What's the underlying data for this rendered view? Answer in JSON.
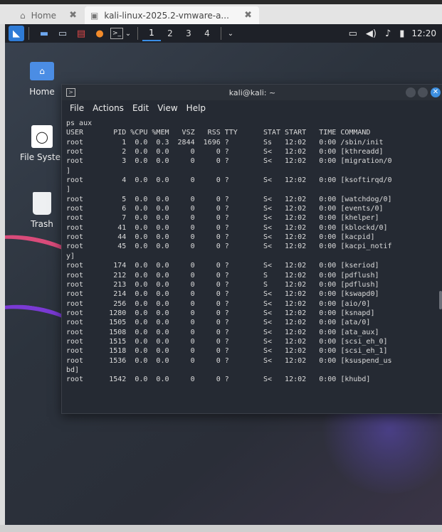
{
  "vm_tabs": [
    {
      "label": "Home",
      "icon": "home-icon"
    },
    {
      "label": "kali-linux-2025.2-vmware-a...",
      "icon": "vm-icon"
    }
  ],
  "panel": {
    "workspaces": [
      "1",
      "2",
      "3",
      "4"
    ],
    "active_workspace": "1",
    "clock": "12:20"
  },
  "desktop_icons": [
    {
      "label": "Home",
      "icon": "home-folder-icon"
    },
    {
      "label": "File Syster",
      "icon": "drive-icon"
    },
    {
      "label": "Trash",
      "icon": "trash-icon"
    }
  ],
  "terminal": {
    "title": "kali@kali: ~",
    "menu": [
      "File",
      "Actions",
      "Edit",
      "View",
      "Help"
    ],
    "lines": [
      "ps aux",
      "USER       PID %CPU %MEM   VSZ   RSS TTY      STAT START   TIME COMMAND",
      "root         1  0.0  0.3  2844  1696 ?        Ss   12:02   0:00 /sbin/init",
      "root         2  0.0  0.0     0     0 ?        S<   12:02   0:00 [kthreadd]",
      "root         3  0.0  0.0     0     0 ?        S<   12:02   0:00 [migration/0",
      "]",
      "root         4  0.0  0.0     0     0 ?        S<   12:02   0:00 [ksoftirqd/0",
      "]",
      "root         5  0.0  0.0     0     0 ?        S<   12:02   0:00 [watchdog/0]",
      "root         6  0.0  0.0     0     0 ?        S<   12:02   0:00 [events/0]",
      "root         7  0.0  0.0     0     0 ?        S<   12:02   0:00 [khelper]",
      "root        41  0.0  0.0     0     0 ?        S<   12:02   0:00 [kblockd/0]",
      "root        44  0.0  0.0     0     0 ?        S<   12:02   0:00 [kacpid]",
      "root        45  0.0  0.0     0     0 ?        S<   12:02   0:00 [kacpi_notif",
      "y]",
      "root       174  0.0  0.0     0     0 ?        S<   12:02   0:00 [kseriod]",
      "root       212  0.0  0.0     0     0 ?        S    12:02   0:00 [pdflush]",
      "root       213  0.0  0.0     0     0 ?        S    12:02   0:00 [pdflush]",
      "root       214  0.0  0.0     0     0 ?        S<   12:02   0:00 [kswapd0]",
      "root       256  0.0  0.0     0     0 ?        S<   12:02   0:00 [aio/0]",
      "root      1280  0.0  0.0     0     0 ?        S<   12:02   0:00 [ksnapd]",
      "root      1505  0.0  0.0     0     0 ?        S<   12:02   0:00 [ata/0]",
      "root      1508  0.0  0.0     0     0 ?        S<   12:02   0:00 [ata_aux]",
      "root      1515  0.0  0.0     0     0 ?        S<   12:02   0:00 [scsi_eh_0]",
      "root      1518  0.0  0.0     0     0 ?        S<   12:02   0:00 [scsi_eh_1]",
      "root      1536  0.0  0.0     0     0 ?        S<   12:02   0:00 [ksuspend_us",
      "bd]",
      "root      1542  0.0  0.0     0     0 ?        S<   12:02   0:00 [khubd]"
    ]
  },
  "colors": {
    "panel_bg": "#1e2128",
    "terminal_bg": "#252a33",
    "accent": "#3d8fe0"
  }
}
